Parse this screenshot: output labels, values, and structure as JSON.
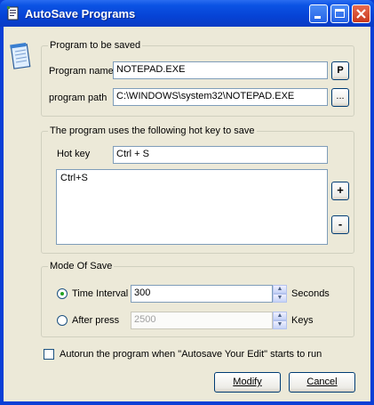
{
  "window": {
    "title": "AutoSave Programs"
  },
  "program_group": {
    "legend": "Program to be saved",
    "name_label": "Program name",
    "name_value": "NOTEPAD.EXE",
    "pick_button": "P",
    "path_label": "program path",
    "path_value": "C:\\WINDOWS\\system32\\NOTEPAD.EXE",
    "browse_button": "..."
  },
  "hotkey_group": {
    "legend": "The program uses the following hot key to save",
    "hotkey_label": "Hot key",
    "hotkey_value": "Ctrl + S",
    "list_items": [
      "Ctrl+S"
    ],
    "add_button": "+",
    "remove_button": "-"
  },
  "mode_group": {
    "legend": "Mode Of Save",
    "time_interval_label": "Time Interval",
    "time_interval_value": "300",
    "time_interval_unit": "Seconds",
    "after_press_label": "After press",
    "after_press_value": "2500",
    "after_press_unit": "Keys",
    "selected": "time_interval"
  },
  "autorun": {
    "label": "Autorun the program when \"Autosave Your Edit\" starts to run",
    "checked": false
  },
  "buttons": {
    "modify": "Modify",
    "cancel": "Cancel"
  }
}
